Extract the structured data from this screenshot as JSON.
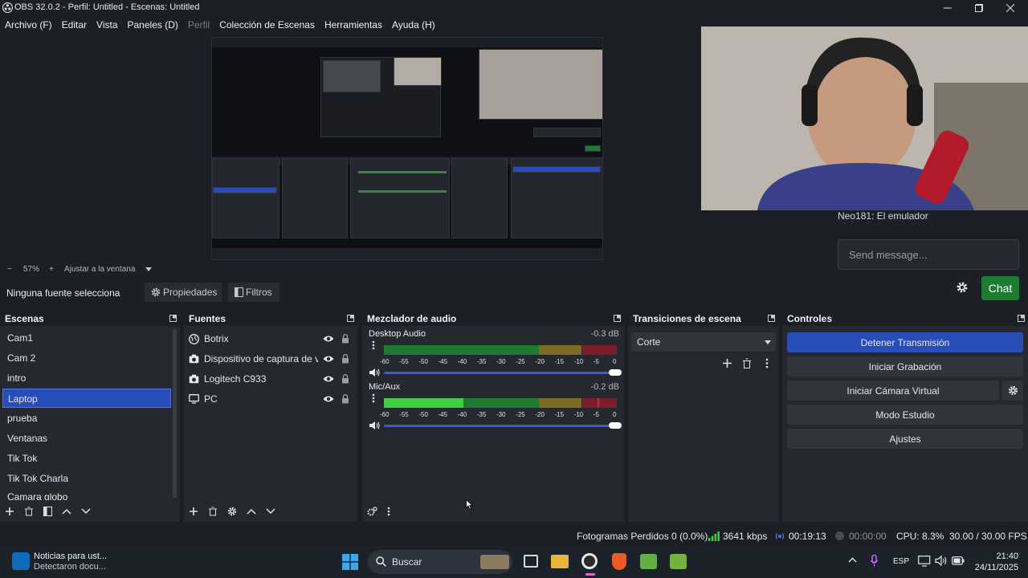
{
  "window": {
    "title": "OBS 32.0.2 - Perfil: Untitled - Escenas: Untitled"
  },
  "menu": [
    {
      "label": "Archivo (F)",
      "disabled": false
    },
    {
      "label": "Editar",
      "disabled": false
    },
    {
      "label": "Vista",
      "disabled": false
    },
    {
      "label": "Paneles (D)",
      "disabled": false
    },
    {
      "label": "Perfil",
      "disabled": true
    },
    {
      "label": "Colección de Escenas",
      "disabled": false
    },
    {
      "label": "Herramientas",
      "disabled": false
    },
    {
      "label": "Ayuda (H)",
      "disabled": false
    }
  ],
  "zoom": {
    "minus": "−",
    "value": "57%",
    "plus": "+",
    "fit": "Ajustar a la ventana"
  },
  "source_toolbar": {
    "none_selected": "Ninguna fuente selecciona",
    "properties": "Propiedades",
    "filters": "Filtros"
  },
  "chat": {
    "last_message": "Neo181: El emulador",
    "placeholder": "Send message...",
    "send": "Chat"
  },
  "scenes": {
    "title": "Escenas",
    "items": [
      "Cam1",
      "Cam 2",
      "intro",
      "Laptop",
      "prueba",
      "Ventanas",
      "Tik Tok",
      "Tik Tok Charla",
      "Camara globo"
    ],
    "selected_index": 3
  },
  "sources": {
    "title": "Fuentes",
    "items": [
      {
        "name": "Botrix",
        "icon": "browser-icon"
      },
      {
        "name": "Dispositivo de captura de video",
        "icon": "camera-icon"
      },
      {
        "name": "Logitech C933",
        "icon": "camera-icon"
      },
      {
        "name": "PC",
        "icon": "monitor-icon"
      }
    ]
  },
  "mixer": {
    "title": "Mezclador de audio",
    "channels": [
      {
        "name": "Desktop Audio",
        "db": "-0.3 dB",
        "level": 0.0,
        "volume": 1.0
      },
      {
        "name": "Mic/Aux",
        "db": "-0.2 dB",
        "level": 0.34,
        "volume": 1.0
      }
    ],
    "ticks": [
      "-60",
      "-55",
      "-50",
      "-45",
      "-40",
      "-35",
      "-30",
      "-25",
      "-20",
      "-15",
      "-10",
      "-5",
      "0"
    ]
  },
  "transitions": {
    "title": "Transiciones de escena",
    "selected": "Corte"
  },
  "controls": {
    "title": "Controles",
    "buttons": [
      "Detener Transmisión",
      "Iniciar Grabación",
      "Iniciar Cámara Virtual",
      "Modo Estudio",
      "Ajustes"
    ]
  },
  "status": {
    "dropped": "Fotogramas Perdidos 0 (0.0%)",
    "bitrate": "3641 kbps",
    "stream_time": "00:19:13",
    "rec_time": "00:00:00",
    "cpu": "CPU: 8.3%",
    "fps": "30.00 / 30.00 FPS"
  },
  "taskbar": {
    "news_title": "Noticias para ust...",
    "news_sub": "Detectaron docu...",
    "search": "Buscar",
    "lang": "ESP",
    "time": "21:40",
    "date": "24/11/2025"
  },
  "colors": {
    "accent": "#284cb8",
    "chat_button": "#1f7a32",
    "meter_green": "#3ecf3e",
    "meter_yellow": "#c7a12c",
    "meter_red": "#c92b3a"
  }
}
